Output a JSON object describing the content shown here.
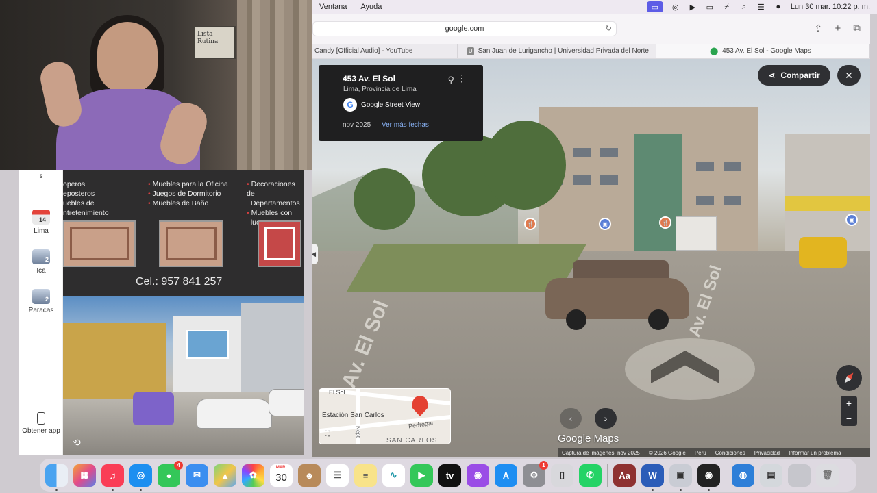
{
  "menubar": {
    "items": [
      "Ventana",
      "Ayuda"
    ],
    "clock": "Lun 30 mar.  10:22 p. m."
  },
  "browser": {
    "url": "google.com",
    "tabs": [
      {
        "label": "Candy [Official Audio] - YouTube"
      },
      {
        "label": "San Juan de Lurigancho | Universidad Privada del Norte",
        "favicon_letter": "U"
      },
      {
        "label": "453 Av. El Sol - Google Maps"
      }
    ]
  },
  "streetview": {
    "card": {
      "title": "453 Av. El Sol",
      "subtitle": "Lima, Provincia de Lima",
      "source": "Google Street View",
      "date": "nov 2025",
      "more_dates": "Ver más fechas"
    },
    "share_label": "Compartir",
    "close_glyph": "✕",
    "road_label": "Av. El Sol",
    "brand": "Google Maps",
    "minimap": {
      "street_top": "El Sol",
      "station": "Estación San Carlos",
      "street_pedregal": "Pedregal",
      "area": "SAN CARLOS",
      "street_nept": "Nept"
    },
    "footer": {
      "capture": "Captura de imágenes: nov 2025",
      "copyright": "© 2026 Google",
      "country": "Perú",
      "terms": "Condiciones",
      "privacy": "Privacidad",
      "report": "Informar un problema"
    }
  },
  "webcam": {
    "board_text": "Lista Rutina"
  },
  "flyer_sidebar": {
    "items": [
      {
        "label": "s"
      },
      {
        "label": "Lima",
        "badge": "14"
      },
      {
        "label": "Ica",
        "badge": "2"
      },
      {
        "label": "Paracas",
        "badge": "2"
      },
      {
        "label": "Obtener app"
      }
    ]
  },
  "poster": {
    "col1": [
      "operos",
      "eposteros",
      "uebles de",
      "ntretenimiento"
    ],
    "col2": [
      "Muebles para la Oficina",
      "Juegos de Dormitorio",
      "Muebles de Baño"
    ],
    "col3": [
      "Decoraciones de",
      "Departamentos",
      "Muebles con",
      "luces LED"
    ],
    "phone": "Cel.: 957 841 257"
  },
  "dock": {
    "calendar_month": "MAR.",
    "calendar_day": "30",
    "messages_badge": "4",
    "settings_badge": "1",
    "dictionary_label": "Aa",
    "word_label": "W",
    "appletv_label": "tv"
  }
}
